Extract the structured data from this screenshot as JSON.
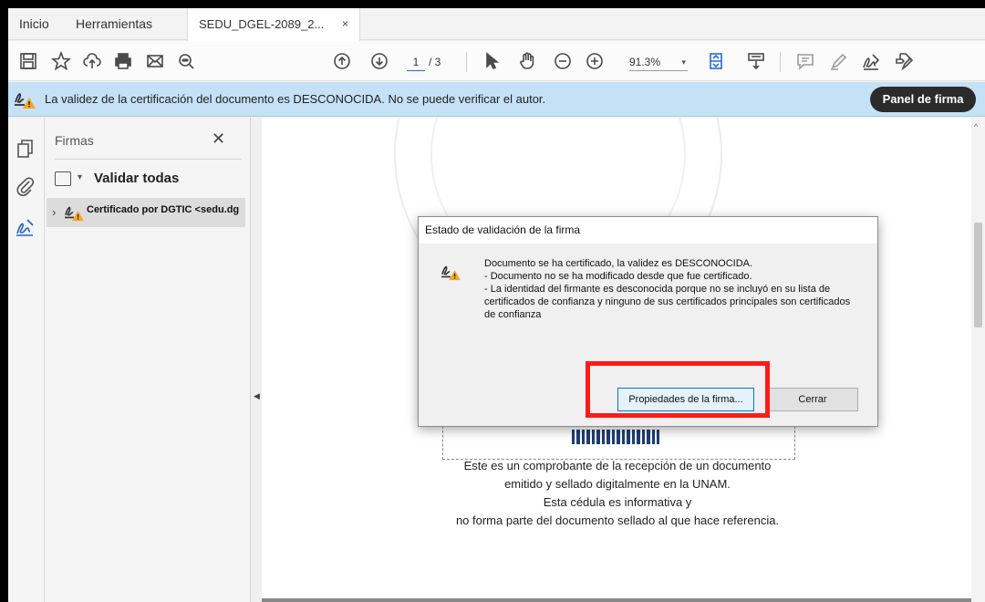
{
  "tabs": {
    "home": "Inicio",
    "tools": "Herramientas",
    "document": "SEDU_DGEL-2089_2...",
    "document_close": "×"
  },
  "toolbar": {
    "page_current": "1",
    "page_total": "/ 3",
    "zoom": "91.3%",
    "zoom_caret": "▾",
    "icons": [
      "save-icon",
      "bookmark-star-icon",
      "cloud-upload-icon",
      "print-icon",
      "email-icon",
      "search-icon",
      "page-up-icon",
      "page-down-icon",
      "select-arrow-icon",
      "hand-pan-icon",
      "zoom-out-icon",
      "zoom-in-icon",
      "fit-page-icon",
      "scroll-mode-icon",
      "comment-icon",
      "highlight-pen-icon",
      "sign-icon",
      "fill-sign-icon"
    ]
  },
  "infobar": {
    "message": "La validez de la certificación del documento es DESCONOCIDA. No se puede verificar el autor.",
    "panel_button": "Panel de firma"
  },
  "signatures_panel": {
    "title": "Firmas",
    "close": "✕",
    "validate_all": "Validar todas",
    "validate_caret": "▾",
    "cert_chevron": "›",
    "certificate_label": "Certificado por DGTIC <sedu.dg"
  },
  "document": {
    "collapse_arrow": "◀",
    "scroll_up": "^",
    "lines": [
      "Este es un comprobante de la recepción de un documento",
      "emitido y sellado digitalmente en la UNAM.",
      "Esta cédula es informativa y",
      "no forma parte del documento sellado al que hace referencia."
    ]
  },
  "dialog": {
    "title": "Estado de validación de la firma",
    "body": [
      "Documento se ha certificado, la validez es DESCONOCIDA.",
      "- Documento no se ha modificado desde que fue certificado.",
      "- La identidad del firmante es desconocida porque no se incluyó en su lista de certificados de confianza y ninguno de sus certificados principales son certificados de confianza"
    ],
    "properties_button": "Propiedades de la firma...",
    "close_button": "Cerrar"
  },
  "colors": {
    "infobar_bg": "#c5e1f6",
    "highlight": "#ff1a1a",
    "warning": "#f5a623"
  }
}
